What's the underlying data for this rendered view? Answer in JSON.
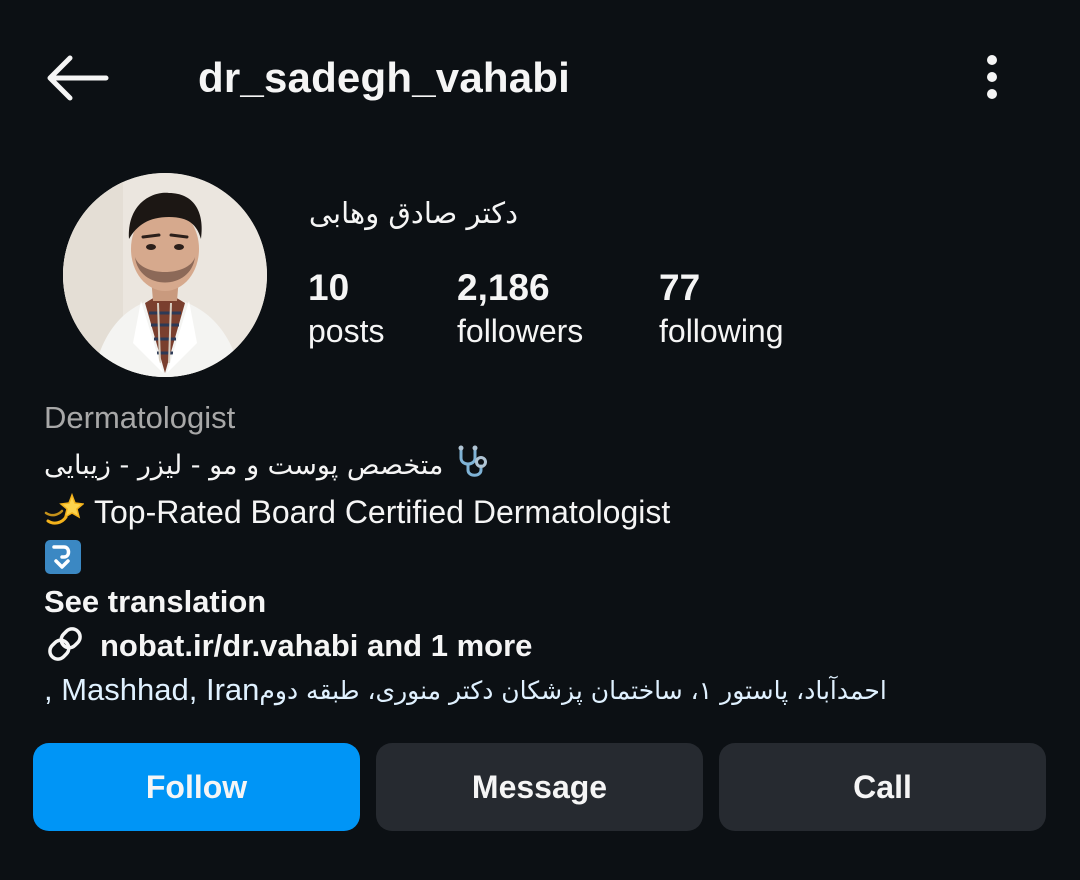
{
  "header": {
    "back_icon": "arrow-left-icon",
    "username": "dr_sadegh_vahabi",
    "more_icon": "more-vertical-icon"
  },
  "profile": {
    "display_name": "دکتر صادق وهابی",
    "stats": [
      {
        "value": "10",
        "label": "posts"
      },
      {
        "value": "2,186",
        "label": "followers"
      },
      {
        "value": "77",
        "label": "following"
      }
    ]
  },
  "bio": {
    "category": "Dermatologist",
    "line_fa": "متخصص پوست و مو - لیزر - زیبایی",
    "line_fa_icon": "stethoscope-icon",
    "line_en_icon": "dizzy-star-icon",
    "line_en": "Top-Rated Board Certified Dermatologist",
    "arrow_icon": "down-arrow-curved-icon",
    "see_translation": "See translation",
    "link_icon": "link-icon",
    "link_text": "nobat.ir/dr.vahabi and 1 more",
    "address_fa": "احمدآباد، پاستور ۱، ساختمان پزشکان دکتر منوری، طبقه دوم",
    "address_en": ", Mashhad, Iran"
  },
  "actions": {
    "follow": "Follow",
    "message": "Message",
    "call": "Call"
  },
  "colors": {
    "background": "#0c1014",
    "primary": "#0095f6",
    "secondary_button": "#262a30",
    "category_text": "#a8a8a8",
    "address_text": "#e0f1ff"
  }
}
